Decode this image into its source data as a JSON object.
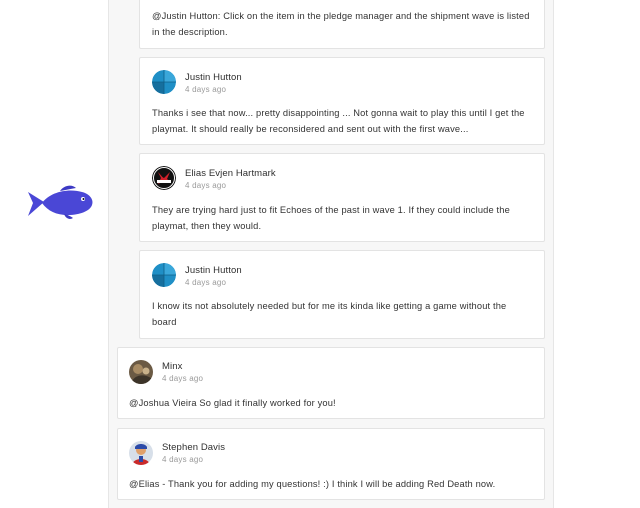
{
  "comments": [
    {
      "id": "c0",
      "body_lines": [
        "@Justin Hutton: Click on the item in the pledge manager and the shipment wave is listed",
        "in the description."
      ]
    },
    {
      "id": "c1",
      "author": "Justin Hutton",
      "time": "4 days ago",
      "avatar": "blue-globe-avatar",
      "body_lines": [
        "Thanks i see that now... pretty disappointing ... Not gonna wait to play this until I get the",
        "playmat. It should really be reconsidered and sent out with the first wave..."
      ]
    },
    {
      "id": "c2",
      "author": "Elias Evjen Hartmark",
      "time": "4 days ago",
      "avatar": "red-black-logo-avatar",
      "body_lines": [
        "They are trying hard just to fit Echoes of the past in wave 1. If they could include the",
        "playmat, then they would."
      ]
    },
    {
      "id": "c3",
      "author": "Justin Hutton",
      "time": "4 days ago",
      "avatar": "blue-globe-avatar",
      "body_lines": [
        "I know its not absolutely needed but for me its kinda like getting a game without the",
        "board"
      ]
    },
    {
      "id": "c4",
      "author": "Minx",
      "time": "4 days ago",
      "avatar": "photo-avatar",
      "body_lines": [
        "@Joshua Vieira So glad it finally worked for you!"
      ]
    },
    {
      "id": "c5",
      "author": "Stephen Davis",
      "time": "4 days ago",
      "avatar": "character-avatar",
      "body_lines": [
        "@Elias - Thank you for adding my questions! :) I think I will be adding Red Death now."
      ]
    }
  ],
  "decorations": {
    "fish": "blue-fish-icon"
  },
  "colors": {
    "fish": "#4a47d6",
    "globe_blue": "#1f8fc6",
    "card_border": "#e3e3e3",
    "feed_bg": "#f7f7f7"
  }
}
